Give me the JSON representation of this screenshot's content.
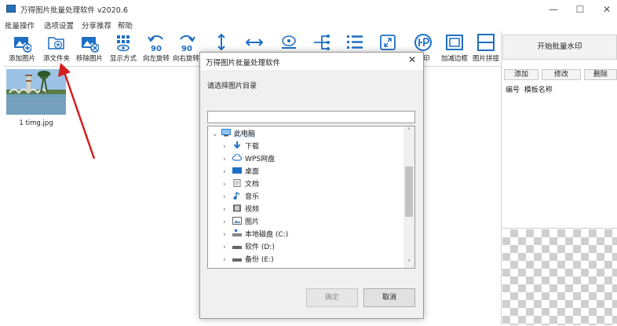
{
  "window": {
    "title": "万得图片批量处理软件 v2020.6",
    "minimize": "—",
    "maximize": "☐",
    "close": "✕"
  },
  "menu": [
    "批量操作",
    "选项设置",
    "分享推荐",
    "帮助"
  ],
  "toolbar": {
    "items": [
      {
        "label": "添加图片",
        "icon": "add-image-icon"
      },
      {
        "label": "添文件夹",
        "icon": "add-folder-icon"
      },
      {
        "label": "移除图片",
        "icon": "remove-image-icon"
      },
      {
        "label": "显示方式",
        "icon": "grid-view-icon"
      },
      {
        "label": "向左旋转",
        "icon": "rotate-left-icon"
      },
      {
        "label": "向右旋转",
        "icon": "rotate-right-icon"
      },
      {
        "label": "",
        "icon": "vertical-resize-icon"
      },
      {
        "label": "",
        "icon": "horizontal-resize-icon"
      },
      {
        "label": "",
        "icon": "stamp-icon"
      },
      {
        "label": "",
        "icon": "split-icon"
      },
      {
        "label": "",
        "icon": "list-icon"
      },
      {
        "label": "",
        "icon": "compress-icon"
      },
      {
        "label": "水印",
        "icon": "watermark-icon"
      },
      {
        "label": "加减边框",
        "icon": "border-icon"
      },
      {
        "label": "图片拼接",
        "icon": "stitch-icon"
      }
    ],
    "rotate_badge": "90"
  },
  "thumbnail": {
    "caption": "1 timg.jpg"
  },
  "right_panel": {
    "start_button": "开始批量水印",
    "tabs": [
      "添加",
      "修改",
      "删除"
    ],
    "list_headers": [
      "编号",
      "模板名称"
    ]
  },
  "dialog": {
    "title": "万得图片批量处理软件",
    "close": "✕",
    "prompt": "请选择图片目录",
    "path_value": "",
    "tree": [
      {
        "label": "此电脑",
        "level": 0,
        "expanded": true,
        "icon": "computer-icon"
      },
      {
        "label": "下载",
        "level": 1,
        "icon": "download-icon"
      },
      {
        "label": "WPS网盘",
        "level": 1,
        "icon": "cloud-icon"
      },
      {
        "label": "桌面",
        "level": 1,
        "icon": "desktop-icon"
      },
      {
        "label": "文档",
        "level": 1,
        "icon": "document-icon"
      },
      {
        "label": "音乐",
        "level": 1,
        "icon": "music-icon"
      },
      {
        "label": "视频",
        "level": 1,
        "icon": "video-icon"
      },
      {
        "label": "图片",
        "level": 1,
        "icon": "pictures-icon"
      },
      {
        "label": "本地磁盘 (C:)",
        "level": 1,
        "icon": "disk-icon"
      },
      {
        "label": "软件 (D:)",
        "level": 1,
        "icon": "drive-icon"
      },
      {
        "label": "备份 (E:)",
        "level": 1,
        "icon": "drive-icon"
      }
    ],
    "ok": "确定",
    "cancel": "取消"
  },
  "colors": {
    "accent": "#1e6fc4",
    "annotation_arrow": "#d21f1f"
  }
}
